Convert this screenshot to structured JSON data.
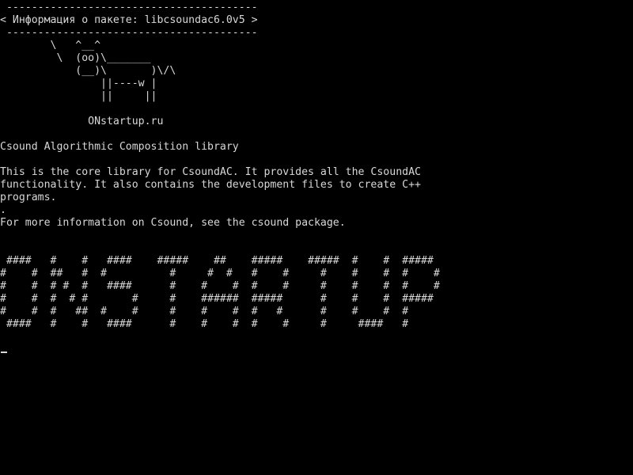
{
  "terminal": {
    "colors": {
      "background": "#000000",
      "foreground": "#d8d8d8"
    },
    "lines": [
      " ----------------------------------------",
      "< Информация о пакете: libcsoundac6.0v5 >",
      " ----------------------------------------",
      "        \\   ^__^",
      "         \\  (oo)\\_______",
      "            (__)\\       )\\/\\",
      "                ||----w |",
      "                ||     ||",
      "",
      "              ONstartup.ru",
      "",
      "Csound Algorithmic Composition library",
      "",
      "This is the core library for CsoundAC. It provides all the CsoundAC",
      "functionality. It also contains the development files to create C++",
      "programs.",
      ".",
      "For more information on Csound, see the csound package.",
      "",
      "",
      " ####   #    #   ####    #####    ##    #####    #####  #    #  #####",
      "#    #  ##   #  #          #     #  #   #    #     #    #    #  #    #",
      "#    #  # #  #   ####      #    #    #  #    #     #    #    #  #    #",
      "#    #  #  # #       #     #    ######  #####      #    #    #  #####",
      "#    #  #   ##  #    #     #    #    #  #   #      #    #    #  #",
      " ####   #    #   ####      #    #    #  #    #     #     ####   #"
    ]
  }
}
